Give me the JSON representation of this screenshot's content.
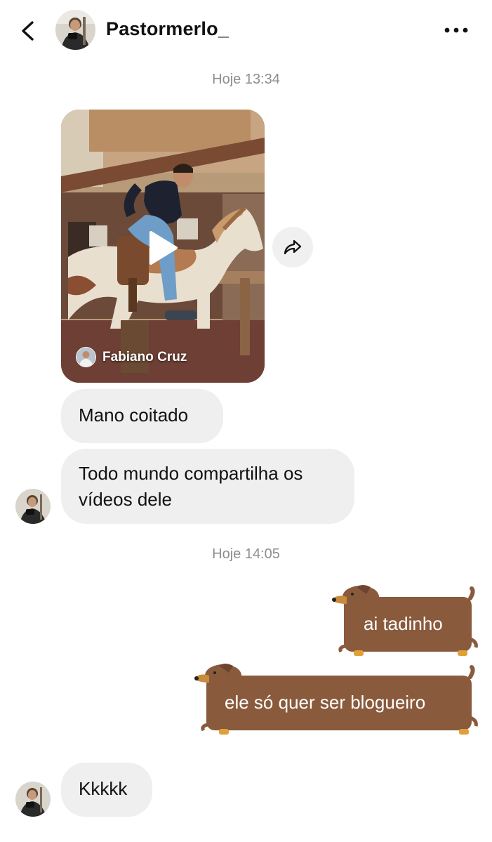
{
  "header": {
    "username": "Pastormerlo_"
  },
  "messages": {
    "time1": "Hoje 13:34",
    "video_author": "Fabiano Cruz",
    "msg1": "Mano coitado",
    "msg2_line1": "Todo mundo compartilha os",
    "msg2_line2": "vídeos dele",
    "time2": "Hoje 14:05",
    "sent1": "ai tadinho",
    "sent2": "ele só quer ser blogueiro",
    "msg3": "Kkkkk"
  },
  "icons": {
    "back": "chevron-left-icon",
    "more": "more-horizontal-icon",
    "share": "share-arrow-icon",
    "play": "play-icon"
  },
  "colors": {
    "bubble_received": "#efefef",
    "sticker_brown": "#8a5a3c",
    "timestamp": "#8e8e8e"
  }
}
